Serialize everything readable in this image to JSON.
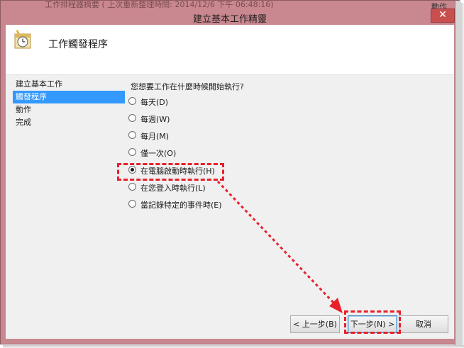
{
  "background": {
    "title_text": "工作排程器摘要 ( 上次重新整理時間: 2014/12/6 下午 06:48:16)",
    "right_text": "動作"
  },
  "dialog": {
    "title": "建立基本工作精靈",
    "close_glyph": "✕"
  },
  "header": {
    "heading": "工作觸發程序",
    "icon": "clock-calendar-icon"
  },
  "nav": {
    "items": [
      {
        "label": "建立基本工作",
        "selected": false
      },
      {
        "label": "觸發程序",
        "selected": true
      },
      {
        "label": "動作",
        "selected": false
      },
      {
        "label": "完成",
        "selected": false
      }
    ]
  },
  "main": {
    "prompt": "您想要工作在什麼時候開始執行?",
    "options": [
      {
        "label": "每天(D)",
        "checked": false
      },
      {
        "label": "每週(W)",
        "checked": false
      },
      {
        "label": "每月(M)",
        "checked": false
      },
      {
        "label": "僅一次(O)",
        "checked": false
      },
      {
        "label": "在電腦啟動時執行(H)",
        "checked": true
      },
      {
        "label": "在您登入時執行(L)",
        "checked": false
      },
      {
        "label": "當記錄特定的事件時(E)",
        "checked": false
      }
    ]
  },
  "buttons": {
    "back": "< 上一步(B)",
    "next": "下一步(N) >",
    "cancel": "取消"
  },
  "colors": {
    "highlight": "#e8202a",
    "selection": "#3399ff",
    "window_frame": "#c9878f"
  }
}
